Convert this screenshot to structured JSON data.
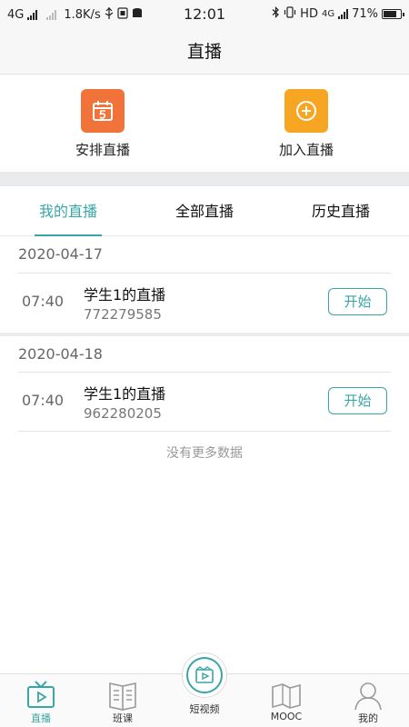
{
  "statusbar": {
    "network": "4G",
    "speed": "1.8K/s",
    "time": "12:01",
    "hd": "HD",
    "net_right": "4G",
    "battery": "71%"
  },
  "header": {
    "title": "直播"
  },
  "actions": [
    {
      "label": "安排直播",
      "icon": "calendar-icon",
      "color": "#f2733a"
    },
    {
      "label": "加入直播",
      "icon": "plus-circle-icon",
      "color": "#f7a623"
    }
  ],
  "tabs": [
    {
      "label": "我的直播",
      "active": true
    },
    {
      "label": "全部直播",
      "active": false
    },
    {
      "label": "历史直播",
      "active": false
    }
  ],
  "groups": [
    {
      "date": "2020-04-17",
      "items": [
        {
          "time": "07:40",
          "title": "学生1的直播",
          "code": "772279585",
          "button": "开始"
        }
      ]
    },
    {
      "date": "2020-04-18",
      "items": [
        {
          "time": "07:40",
          "title": "学生1的直播",
          "code": "962280205",
          "button": "开始"
        }
      ]
    }
  ],
  "no_more": "没有更多数据",
  "nav": [
    {
      "label": "直播",
      "icon": "tv-icon",
      "active": true
    },
    {
      "label": "班课",
      "icon": "book-icon",
      "active": false
    },
    {
      "label": "短视频",
      "icon": "video-icon",
      "active": false
    },
    {
      "label": "MOOC",
      "icon": "open-book-icon",
      "active": false
    },
    {
      "label": "我的",
      "icon": "person-icon",
      "active": false
    }
  ],
  "colors": {
    "accent": "#3aa5a5",
    "orange": "#f2733a",
    "amber": "#f7a623"
  }
}
